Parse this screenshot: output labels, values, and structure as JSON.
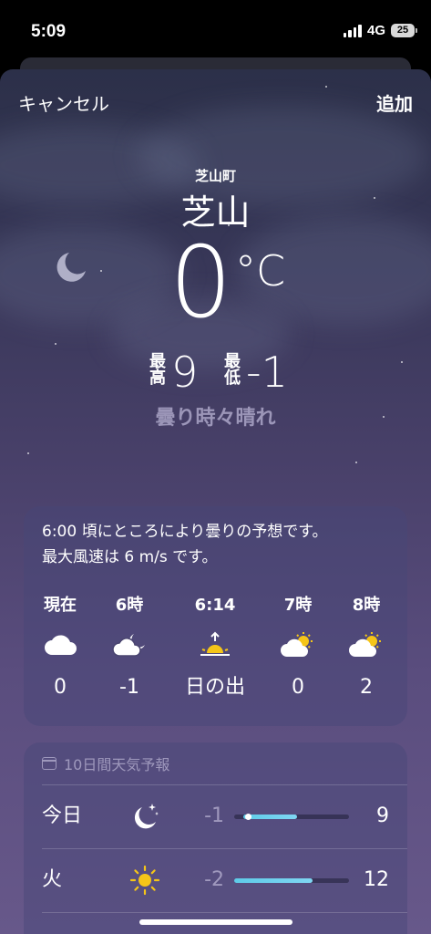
{
  "status_bar": {
    "time": "5:09",
    "network": "4G",
    "battery": "25"
  },
  "nav": {
    "cancel_label": "キャンセル",
    "add_label": "追加"
  },
  "location": {
    "sub": "芝山町",
    "name": "芝山"
  },
  "current": {
    "temperature": "0",
    "unit": "°C",
    "high_label": "最高",
    "high": "9",
    "low_label": "最低",
    "low": "-1",
    "condition": "曇り時々晴れ"
  },
  "hourly_card": {
    "summary_line1": "6:00 頃にところにより曇りの予想です。",
    "summary_line2": "最大風速は 6 m/s です。",
    "hours": [
      {
        "label": "現在",
        "icon": "cloud-icon",
        "value": "0"
      },
      {
        "label": "6時",
        "icon": "cloud-moon-icon",
        "value": "-1"
      },
      {
        "label": "6:14",
        "icon": "sunrise-icon",
        "value": "日の出"
      },
      {
        "label": "7時",
        "icon": "cloud-sun-icon",
        "value": "0"
      },
      {
        "label": "8時",
        "icon": "cloud-sun-icon",
        "value": "2"
      }
    ]
  },
  "ten_day": {
    "header": "10日間天気予報",
    "days": [
      {
        "name": "今日",
        "icon": "moon-stars-icon",
        "low": "-1",
        "high": "9",
        "range_start": 0.08,
        "range_end": 0.55,
        "current_marker": 0.08
      },
      {
        "name": "火",
        "icon": "sun-icon",
        "low": "-2",
        "high": "12",
        "range_start": 0.0,
        "range_end": 0.68
      }
    ]
  },
  "colors": {
    "range_bar": "#5ecbe8",
    "sun": "#f5c518",
    "condition_text": "#b8b2d4"
  }
}
